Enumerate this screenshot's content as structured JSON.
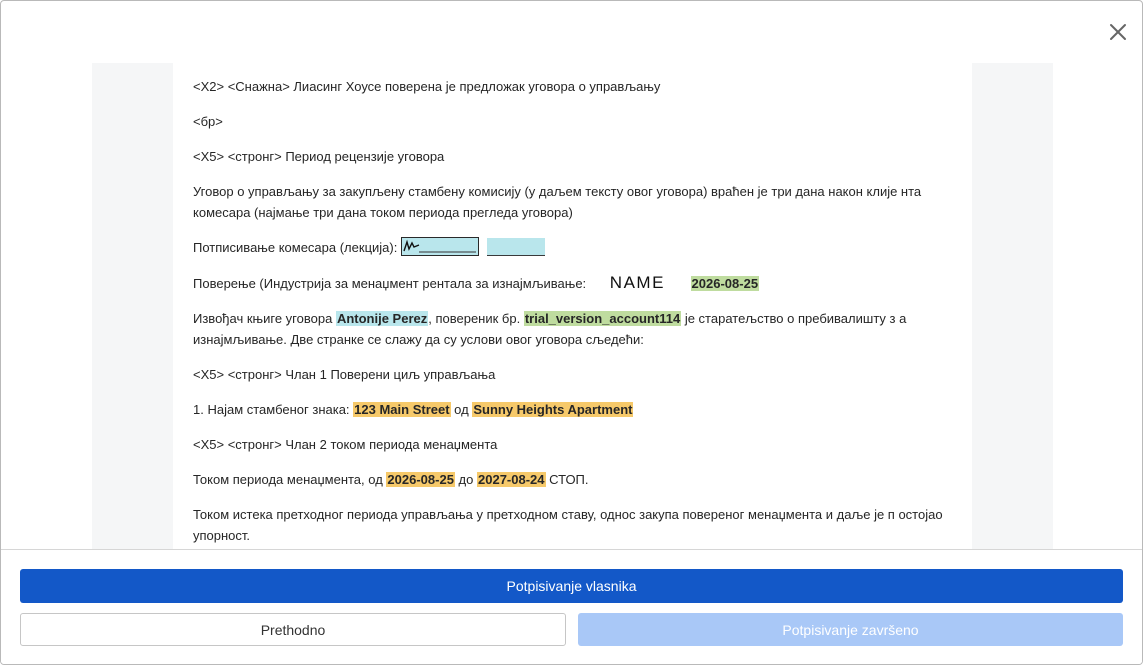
{
  "dialog": {
    "close_icon": "close-icon"
  },
  "document": {
    "line1": "<X2> <Снажна> Лиасинг Хоусе поверена је предложак уговора о управљању",
    "line2": "<бр>",
    "line3": "<X5> <стронг> Период рецензије уговора",
    "line4": "Уговор о управљању за закупљену стамбену комисију (у даљем тексту овог уговора) враћен је три дана након клије нта комесара (најмање три дана током периода прегледа уговора)",
    "sign_label": "Потписивање комесара (лекција):",
    "trust_label": "Поверење (Индустрија за менаџмент рентала за изнајмљивање:",
    "trust_signature": "NAME",
    "trust_date": "2026-08-25",
    "performer_prefix": "Извођач књиге уговора",
    "performer_name": "Antonije Perez",
    "performer_mid": ", повереник бр.",
    "performer_account": "trial_version_account114",
    "performer_suffix": " је старатељство о пребивалишту з а изнајмљивање. Две странке се слажу да су услови овог уговора сљедећи:",
    "art1_heading": "<X5> <стронг> Члан 1 Поверени циљ управљања",
    "art1_prefix": "1. Најам стамбеног знака:",
    "art1_address": "123 Main Street",
    "art1_mid": "од",
    "art1_building": "Sunny Heights Apartment",
    "art2_heading": "<X5> <стронг> Члан 2 током периода менаџмента",
    "period_prefix": "Током периода менаџмента, од",
    "period_from": "2026-08-25",
    "period_mid": "до",
    "period_to": "2027-08-24",
    "period_suffix": "СТОП.",
    "last_para": "Током истека претходног периода управљања у претходном ставу, однос закупа повереног менаџмента и даље је п остојао упорност."
  },
  "footer": {
    "primary_label": "Potpisivanje vlasnika",
    "prev_label": "Prethodno",
    "done_label": "Potpisivanje završeno"
  },
  "colors": {
    "primary": "#1358c8",
    "disabled": "#a9c8f7",
    "highlight_cyan": "#b9e6ec",
    "highlight_green": "#bfdc9f",
    "highlight_orange": "#f6c96a"
  }
}
